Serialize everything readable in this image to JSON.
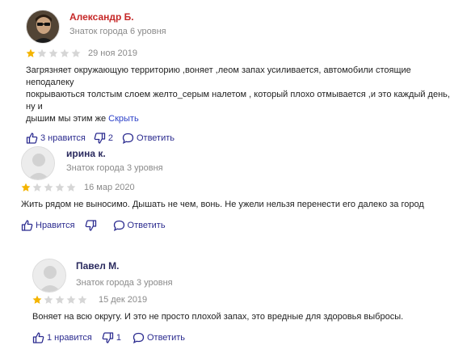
{
  "colors": {
    "star_filled": "#f4b400",
    "star_empty": "#d6d6d6",
    "link": "#2a3fc8",
    "name_red": "#c62828"
  },
  "reviews": [
    {
      "author": "Александр Б.",
      "level": "Знаток города 6 уровня",
      "rating": 1,
      "date": "29 ноя 2019",
      "text_lines": [
        "Загрязняет окружающую территорию ,воняет ,леом запах усиливается, автомобили стоящие неподалеку",
        "покрываються толстым слоем желто_серым налетом , который плохо отмывается ,и это каждый день, ну и",
        "дышим мы этим же"
      ],
      "hide_link": "Скрыть",
      "like_label": "3 нравится",
      "dislike_count": "2",
      "reply_label": "Ответить"
    },
    {
      "author": "ирина к.",
      "level": "Знаток города 3 уровня",
      "rating": 1,
      "date": "16 мар 2020",
      "text": "Жить рядом не выносимо. Дышать не чем, вонь. Не ужели нельзя перенести его далеко за город",
      "like_label": "Нравится",
      "dislike_count": "",
      "reply_label": "Ответить"
    },
    {
      "author": "Павел М.",
      "level": "Знаток города 3 уровня",
      "rating": 1,
      "date": "15 дек 2019",
      "text": "Воняет на всю округу. И это не просто плохой запах, это вредные для здоровья выбросы.",
      "like_label": "1 нравится",
      "dislike_count": "1",
      "reply_label": "Ответить"
    }
  ]
}
